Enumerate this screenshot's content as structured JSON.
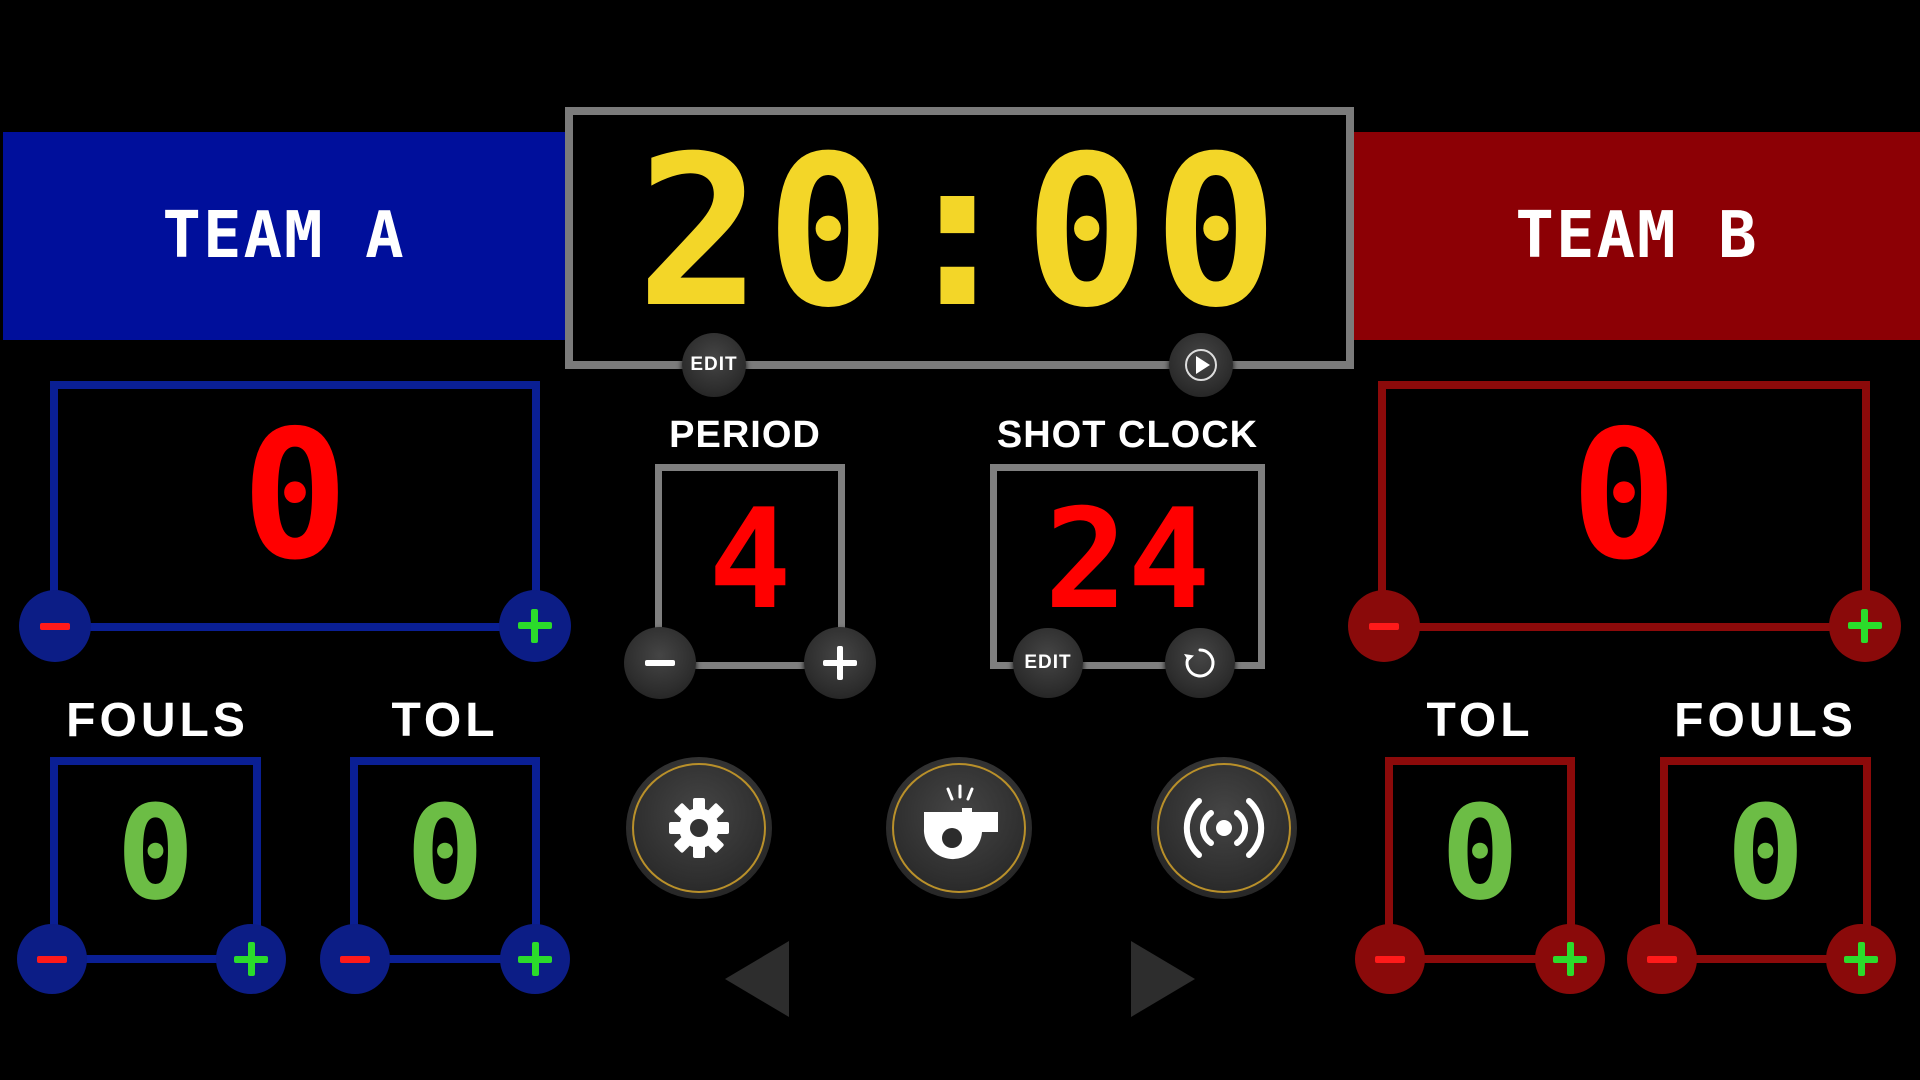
{
  "team_a": {
    "name": "TEAM A",
    "score": "0",
    "fouls_label": "FOULS",
    "fouls": "0",
    "tol_label": "TOL",
    "tol": "0",
    "color": "#000f9b"
  },
  "team_b": {
    "name": "TEAM B",
    "score": "0",
    "fouls_label": "FOULS",
    "fouls": "0",
    "tol_label": "TOL",
    "tol": "0",
    "color": "#8c0005"
  },
  "clock": {
    "time": "20:00",
    "edit_label": "EDIT",
    "color": "#f3d628"
  },
  "period": {
    "label": "PERIOD",
    "value": "4"
  },
  "shot_clock": {
    "label": "SHOT CLOCK",
    "value": "24",
    "edit_label": "EDIT"
  },
  "icons": {
    "play": "play-icon",
    "settings": "gear-icon",
    "whistle": "whistle-icon",
    "broadcast": "broadcast-icon",
    "reset": "reset-icon",
    "prev": "chevron-left-icon",
    "next": "chevron-right-icon"
  }
}
